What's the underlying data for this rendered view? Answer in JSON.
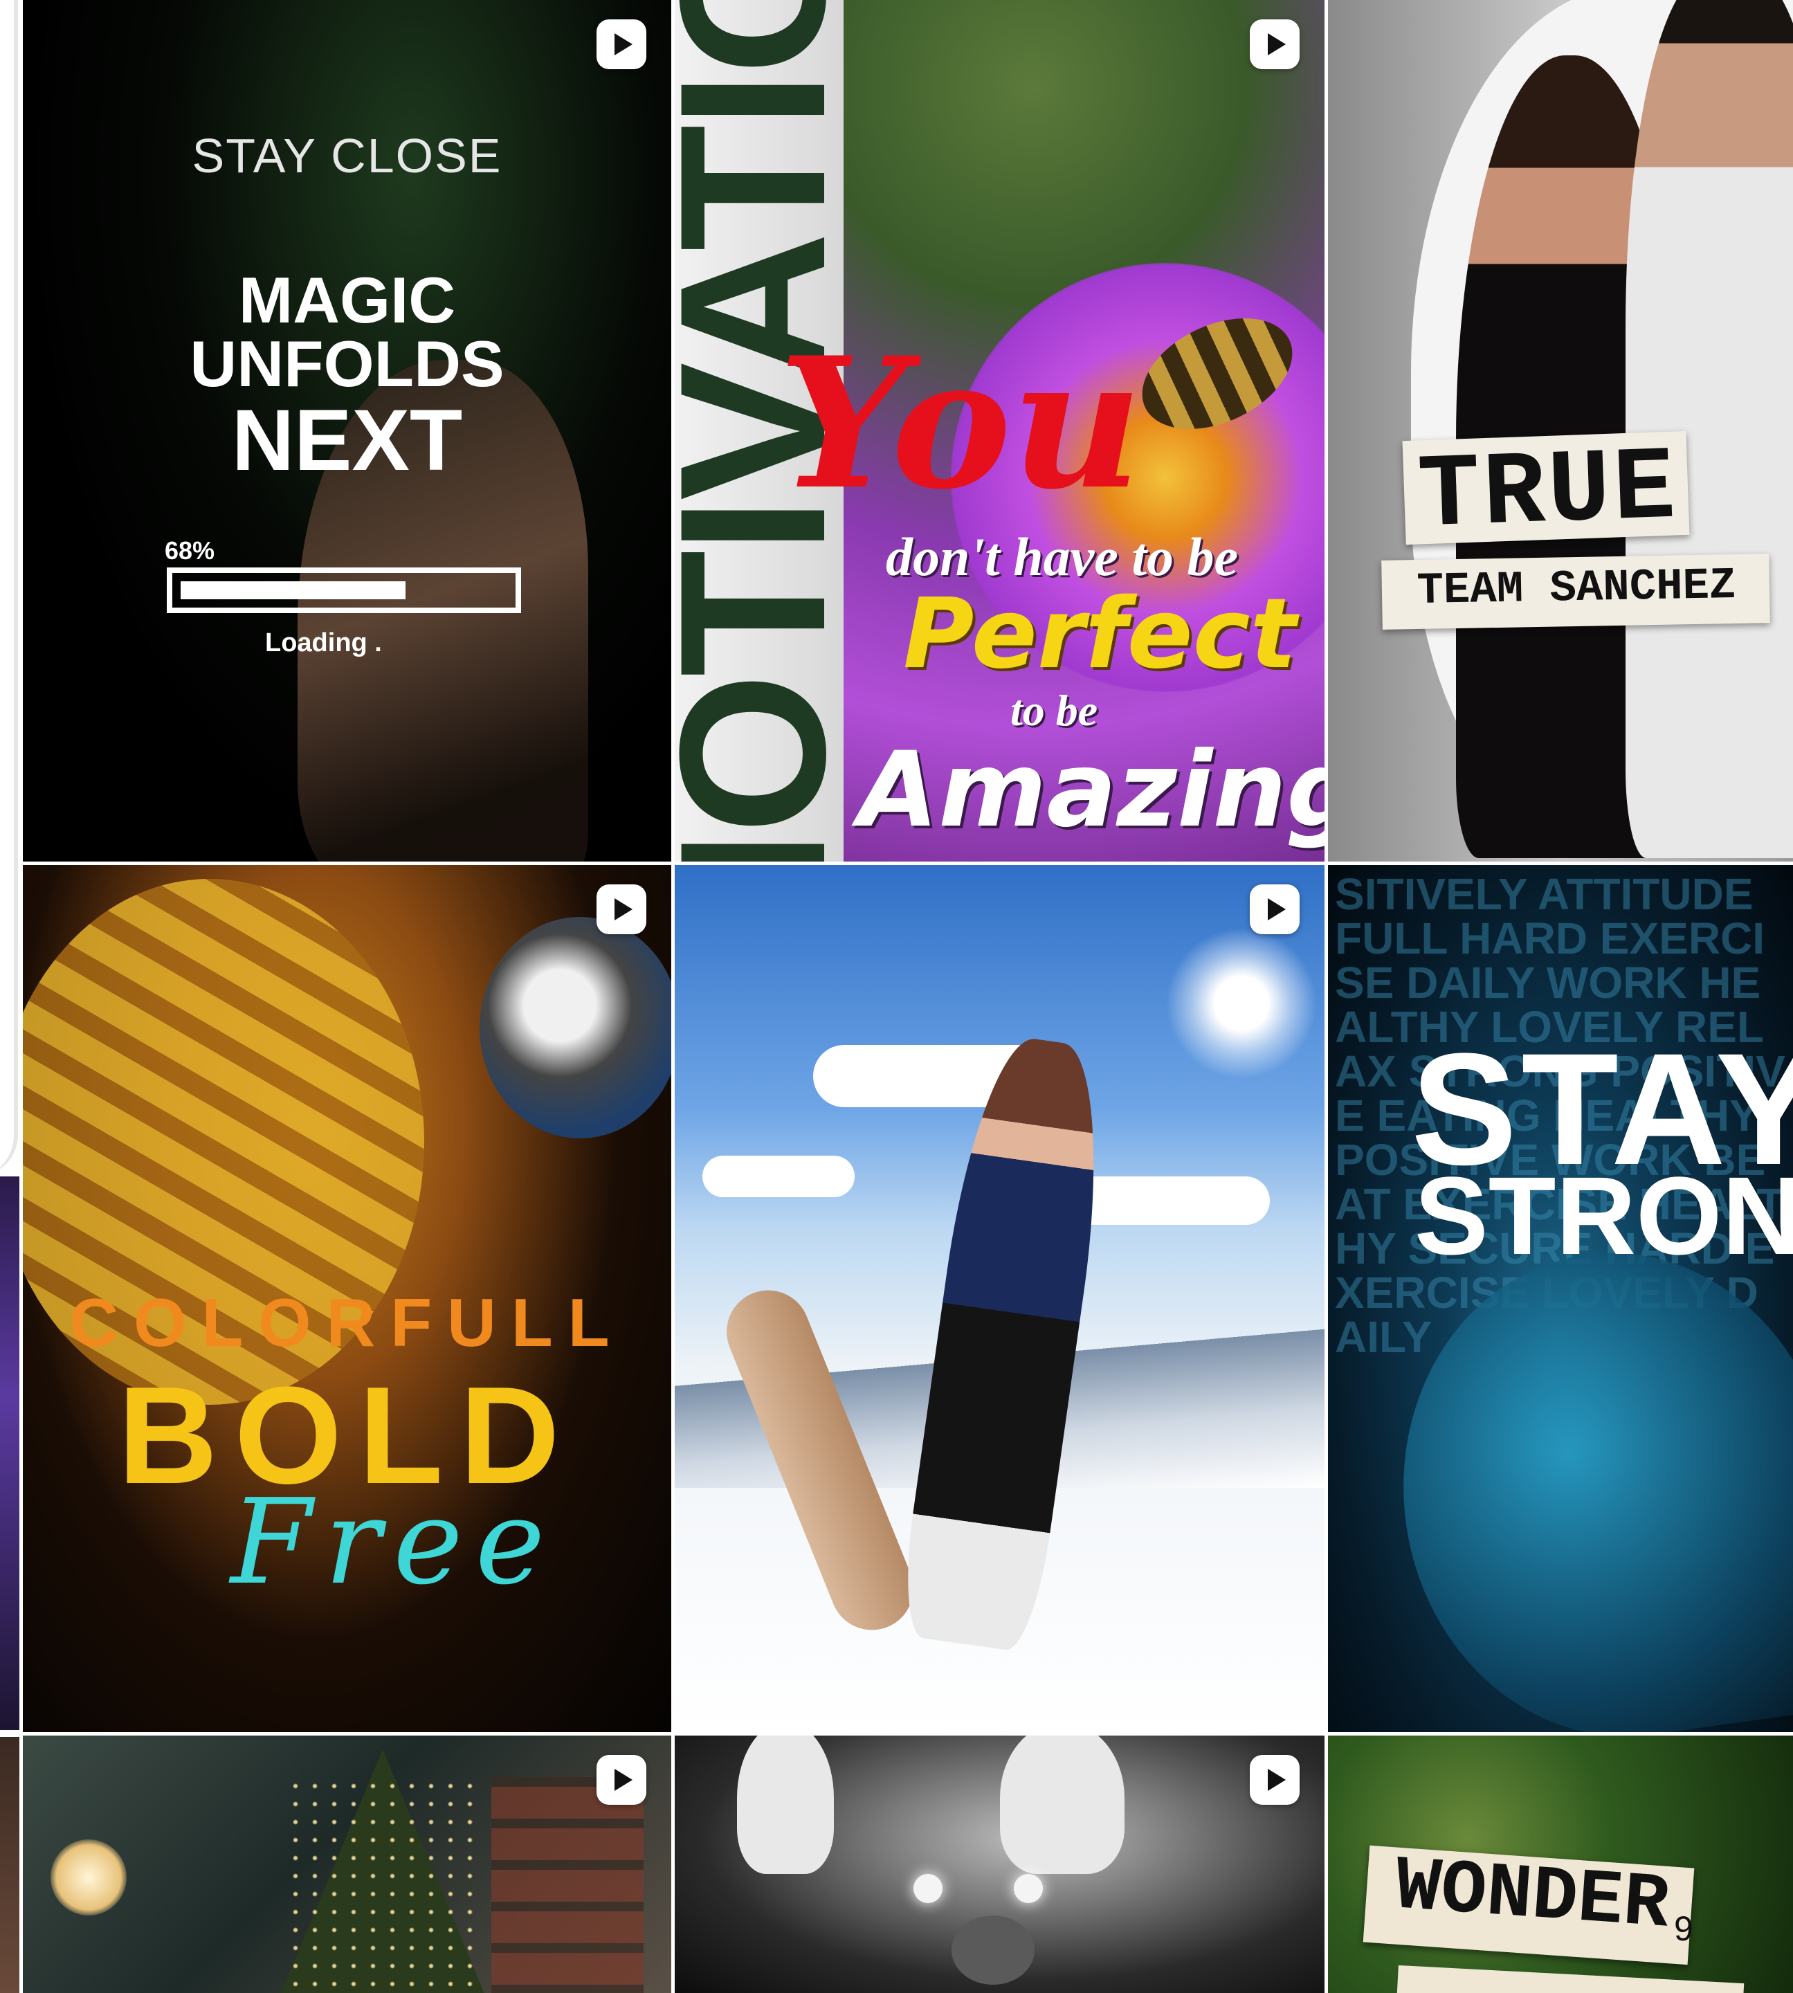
{
  "reels": [
    {
      "id": "reel-1",
      "text": [
        "STAY CLOSE",
        "MAGIC",
        "UNFOLDS",
        "NEXT",
        "68%",
        "Loading ."
      ],
      "progress": 0.68
    },
    {
      "id": "reel-2",
      "text": [
        "MOTIVATION",
        "You",
        "don't have to be",
        "Perfect",
        "to be",
        "Amazing"
      ]
    },
    {
      "id": "reel-3",
      "text": [
        "TRUE",
        "TEAM SANCHEZ"
      ]
    },
    {
      "id": "reel-4",
      "text": [
        "COLORFULL",
        "BOLD",
        "Free"
      ]
    },
    {
      "id": "reel-5",
      "text": []
    },
    {
      "id": "reel-6",
      "text": [
        "STAY",
        "STRONG"
      ],
      "background_words": "SITIVELY ATTITUDE FULL HARD EXERCISE DAILY WORK HEALTHY LOVELY RELAX STRONG POSITIVE EATING HEALTHY POSITIVE WORK BEAT EXERCISE HEALTHY SECURE HARD EXERCISE LOVELY DAILY"
    },
    {
      "id": "reel-7",
      "text": []
    },
    {
      "id": "reel-8",
      "text": []
    },
    {
      "id": "reel-9",
      "text": [
        "WONDER"
      ]
    }
  ],
  "page_number": "9",
  "icon": "reel-play-icon",
  "colors": {
    "background": "#ffffff",
    "accent_red": "#e5101c",
    "accent_yellow": "#f6c417",
    "accent_orange": "#f08a1e",
    "accent_cyan": "#3ed6d6"
  }
}
